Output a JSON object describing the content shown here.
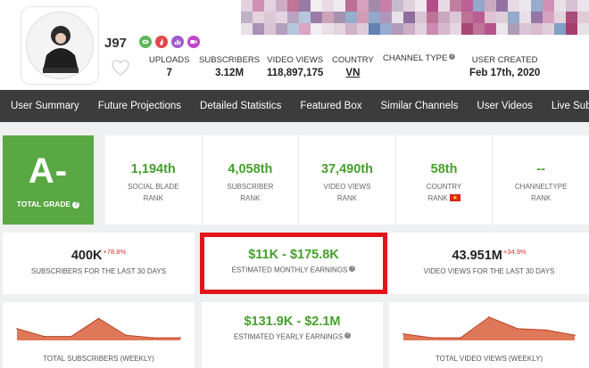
{
  "channel": {
    "name": "J97",
    "badges": [
      {
        "icon": "eye-icon",
        "color": "#5cb85c"
      },
      {
        "icon": "flame-icon",
        "color": "#e4474b"
      },
      {
        "icon": "chart-icon",
        "color": "#a259cf"
      },
      {
        "icon": "video-camera-icon",
        "color": "#c145c9"
      }
    ]
  },
  "stats": [
    {
      "label": "UPLOADS",
      "value": "7"
    },
    {
      "label": "SUBSCRIBERS",
      "value": "3.12M"
    },
    {
      "label": "VIDEO VIEWS",
      "value": "118,897,175"
    },
    {
      "label": "COUNTRY",
      "value": "VN"
    },
    {
      "label": "CHANNEL TYPE",
      "value": ""
    },
    {
      "label": "USER CREATED",
      "value": "Feb 17th, 2020"
    }
  ],
  "nav": [
    "User Summary",
    "Future Projections",
    "Detailed Statistics",
    "Featured Box",
    "Similar Channels",
    "User Videos",
    "Live Subscriber C"
  ],
  "grade": {
    "letter": "A-",
    "label": "TOTAL GRADE"
  },
  "ranks": [
    {
      "value": "1,194th",
      "line1": "SOCIAL BLADE",
      "line2": "RANK"
    },
    {
      "value": "4,058th",
      "line1": "SUBSCRIBER",
      "line2": "RANK"
    },
    {
      "value": "37,490th",
      "line1": "VIDEO VIEWS",
      "line2": "RANK"
    },
    {
      "value": "58th",
      "line1": "COUNTRY",
      "line2": "RANK"
    },
    {
      "value": "--",
      "line1": "CHANNELTYPE",
      "line2": "RANK"
    }
  ],
  "summary": {
    "subs_30": {
      "value": "400K",
      "delta": "+78.8%",
      "label": "SUBSCRIBERS FOR THE LAST 30 DAYS"
    },
    "monthly": {
      "value": "$11K - $175.8K",
      "label": "ESTIMATED MONTHLY EARNINGS"
    },
    "views_30": {
      "value": "43.951M",
      "delta": "+34.9%",
      "label": "VIDEO VIEWS FOR THE LAST 30 DAYS"
    },
    "yearly": {
      "value": "$131.9K - $2.1M",
      "label": "ESTIMATED YEARLY EARNINGS"
    }
  },
  "charts": {
    "subscribers_label": "TOTAL SUBSCRIBERS (WEEKLY)",
    "views_label": "TOTAL VIDEO VIEWS (WEEKLY)",
    "color": "#d9603b"
  },
  "chart_data": [
    {
      "type": "area",
      "title": "TOTAL SUBSCRIBERS (WEEKLY)",
      "values": [
        0.45,
        0.15,
        0.15,
        0.85,
        0.2,
        0.1,
        0.1
      ]
    },
    {
      "type": "area",
      "title": "TOTAL VIDEO VIEWS (WEEKLY)",
      "values": [
        0.25,
        0.1,
        0.1,
        0.9,
        0.45,
        0.4,
        0.2
      ]
    }
  ]
}
